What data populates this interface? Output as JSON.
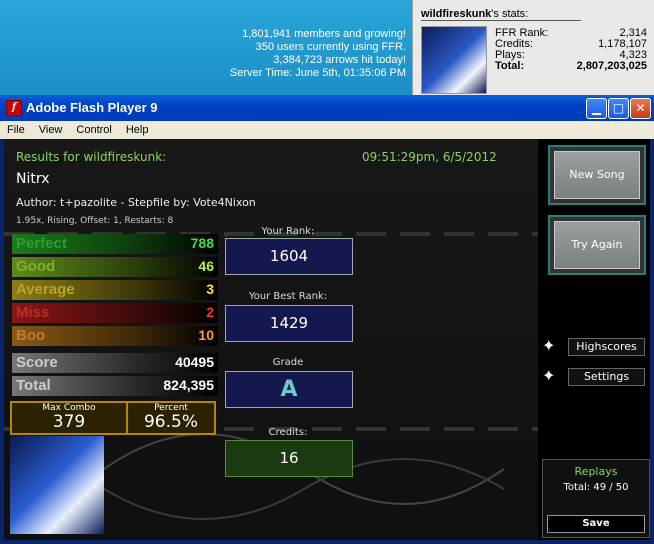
{
  "site": {
    "members": "1,801,941 members and growing!",
    "users": "350 users currently using FFR.",
    "arrows": "3,384,723 arrows hit today!",
    "server_time": "Server Time: June 5th, 01:35:06 PM"
  },
  "user_panel": {
    "name": "wildfireskunk",
    "suffix": "'s stats:",
    "rows": [
      {
        "label": "FFR Rank:",
        "value": "2,314"
      },
      {
        "label": "Credits:",
        "value": "1,178,107"
      },
      {
        "label": "Plays:",
        "value": "4,323"
      }
    ],
    "total": {
      "label": "Total:",
      "value": "2,807,203,025"
    }
  },
  "window": {
    "title": "Adobe Flash Player 9",
    "menu": [
      "File",
      "View",
      "Control",
      "Help"
    ]
  },
  "results": {
    "header": "Results for wildfireskunk:",
    "datetime": "09:51:29pm, 6/5/2012",
    "song": "Nitrx",
    "author_line": "Author: t+pazolite  -  Stepfile by: Vote4Nixon",
    "settings_line": "1.95x, Rising, Offset: 1, Restarts: 8"
  },
  "judgements": [
    {
      "label": "Perfect",
      "value": "788",
      "color": "#1a7d1a",
      "text": "#3fe03f"
    },
    {
      "label": "Good",
      "value": "46",
      "color": "#5e8c1a",
      "text": "#b8f04a"
    },
    {
      "label": "Average",
      "value": "3",
      "color": "#8a7d14",
      "text": "#ffe040"
    },
    {
      "label": "Miss",
      "value": "2",
      "color": "#8a1616",
      "text": "#ff3030"
    },
    {
      "label": "Boo",
      "value": "10",
      "color": "#8a5a14",
      "text": "#ff9a30"
    }
  ],
  "score": {
    "label": "Score",
    "value": "40495"
  },
  "total": {
    "label": "Total",
    "value": "824,395"
  },
  "max_combo": {
    "label": "Max Combo",
    "value": "379"
  },
  "percent": {
    "label": "Percent",
    "value": "96.5%"
  },
  "rank": {
    "label": "Your Rank:",
    "value": "1604"
  },
  "best_rank": {
    "label": "Your Best Rank:",
    "value": "1429"
  },
  "grade": {
    "label": "Grade",
    "value": "A"
  },
  "credits": {
    "label": "Credits:",
    "value": "16"
  },
  "buttons": {
    "new_song": "New Song",
    "try_again": "Try Again",
    "highscores": "Highscores",
    "settings": "Settings"
  },
  "replays": {
    "title": "Replays",
    "total": "Total: 49 / 50",
    "save": "Save"
  }
}
